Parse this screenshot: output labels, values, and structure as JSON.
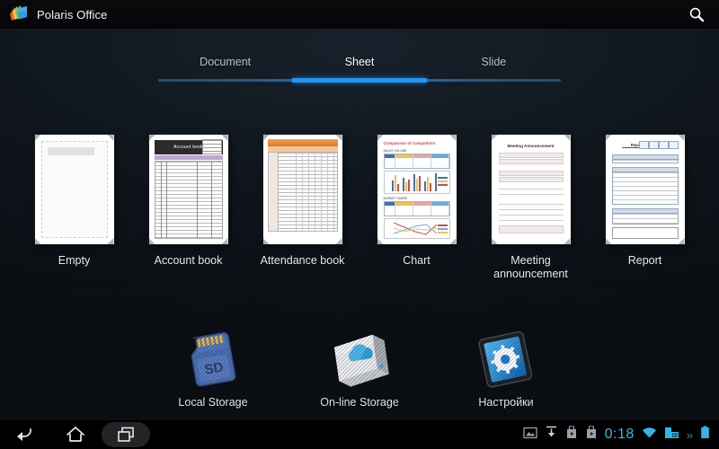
{
  "titlebar": {
    "app_name": "Polaris Office",
    "logo_icon": "polaris-logo-icon",
    "search_icon": "search-icon"
  },
  "tabs": {
    "items": [
      {
        "label": "Document",
        "active": false
      },
      {
        "label": "Sheet",
        "active": true
      },
      {
        "label": "Slide",
        "active": false
      }
    ],
    "active_index": 1,
    "accent_color": "#2196f3",
    "rail_color": "#2a6fa8"
  },
  "templates": [
    {
      "label": "Empty",
      "kind": "empty"
    },
    {
      "label": "Account book",
      "kind": "account-book",
      "thumb_title": "Account book"
    },
    {
      "label": "Attendance book",
      "kind": "attendance-book"
    },
    {
      "label": "Chart",
      "kind": "chart",
      "thumb_title": "Comparison of Competitors",
      "thumb_sub1": "SALES VOLUME",
      "thumb_sub2": "MARKET SHARE"
    },
    {
      "label": "Meeting announcement",
      "kind": "meeting",
      "thumb_title": "Meeting Announcement"
    },
    {
      "label": "Report",
      "kind": "report",
      "thumb_title": "Report"
    }
  ],
  "storage_shortcuts": [
    {
      "label": "Local Storage",
      "icon": "sd-card-icon"
    },
    {
      "label": "On-line Storage",
      "icon": "cloud-drive-icon"
    },
    {
      "label": "Настройки",
      "icon": "settings-tablet-icon"
    }
  ],
  "system_bar": {
    "back_icon": "back-icon",
    "home_icon": "home-icon",
    "recents_icon": "recent-apps-icon",
    "status_icons": [
      "screenshot-icon",
      "download-icon",
      "play-store-icon",
      "play-store-icon"
    ],
    "clock": "0:18",
    "wifi_icon": "wifi-icon",
    "keyboard_icon": "keyboard-icon",
    "overflow": "»",
    "battery_icon": "battery-icon",
    "accent_color": "#33b5e5"
  }
}
